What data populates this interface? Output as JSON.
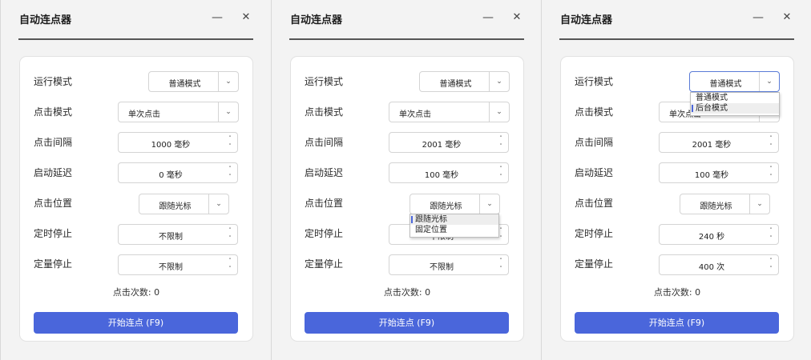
{
  "windows": [
    {
      "title": "自动连点器",
      "minimize_glyph": "—",
      "close_glyph": "✕",
      "run_mode": {
        "label": "运行模式",
        "value": "普通模式",
        "arrow": "⌄"
      },
      "click_mode": {
        "label": "点击模式",
        "value": "单次点击",
        "arrow": "⌄"
      },
      "interval": {
        "label": "点击间隔",
        "value": "1000  毫秒",
        "up": "˄",
        "down": "˅"
      },
      "delay": {
        "label": "启动延迟",
        "value": "0  毫秒",
        "up": "˄",
        "down": "˅"
      },
      "position": {
        "label": "点击位置",
        "value": "跟随光标",
        "arrow": "⌄"
      },
      "timed_stop": {
        "label": "定时停止",
        "value": "不限制",
        "up": "˄",
        "down": "˅"
      },
      "count_stop": {
        "label": "定量停止",
        "value": "不限制",
        "up": "˄",
        "down": "˅"
      },
      "click_count": "点击次数: 0",
      "start_button": "开始连点 (F9)"
    },
    {
      "title": "自动连点器",
      "minimize_glyph": "—",
      "close_glyph": "✕",
      "run_mode": {
        "label": "运行模式",
        "value": "普通模式",
        "arrow": "⌄"
      },
      "click_mode": {
        "label": "点击模式",
        "value": "单次点击",
        "arrow": "⌄"
      },
      "interval": {
        "label": "点击间隔",
        "value": "2001  毫秒",
        "up": "˄",
        "down": "˅"
      },
      "delay": {
        "label": "启动延迟",
        "value": "100  毫秒",
        "up": "˄",
        "down": "˅"
      },
      "position": {
        "label": "点击位置",
        "value": "跟随光标",
        "arrow": "⌄",
        "options": [
          "跟随光标",
          "固定位置"
        ]
      },
      "timed_stop": {
        "label": "定时停止",
        "value": "不限制",
        "up": "˄",
        "down": "˅"
      },
      "count_stop": {
        "label": "定量停止",
        "value": "不限制",
        "up": "˄",
        "down": "˅"
      },
      "click_count": "点击次数: 0",
      "start_button": "开始连点 (F9)"
    },
    {
      "title": "自动连点器",
      "minimize_glyph": "—",
      "close_glyph": "✕",
      "run_mode": {
        "label": "运行模式",
        "value": "普通模式",
        "arrow": "⌄",
        "options": [
          "普通模式",
          "后台模式"
        ]
      },
      "click_mode": {
        "label": "点击模式",
        "value": "单次点击",
        "arrow": "⌄"
      },
      "interval": {
        "label": "点击间隔",
        "value": "2001  毫秒",
        "up": "˄",
        "down": "˅"
      },
      "delay": {
        "label": "启动延迟",
        "value": "100  毫秒",
        "up": "˄",
        "down": "˅"
      },
      "position": {
        "label": "点击位置",
        "value": "跟随光标",
        "arrow": "⌄"
      },
      "timed_stop": {
        "label": "定时停止",
        "value": "240  秒",
        "up": "˄",
        "down": "˅"
      },
      "count_stop": {
        "label": "定量停止",
        "value": "400  次",
        "up": "˄",
        "down": "˅"
      },
      "click_count": "点击次数: 0",
      "start_button": "开始连点 (F9)"
    }
  ],
  "colors": {
    "accent": "#4a66db",
    "focus_border": "#5a7bd6"
  }
}
